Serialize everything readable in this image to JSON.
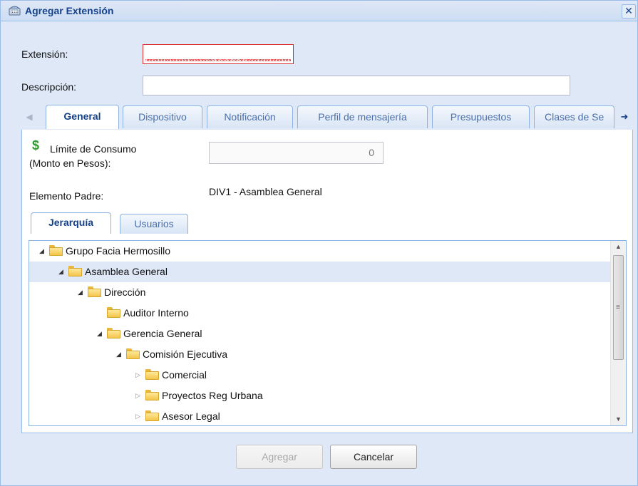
{
  "dialog": {
    "title": "Agregar Extensión",
    "close_symbol": "✕"
  },
  "form": {
    "extension_label": "Extensión:",
    "extension_value": "",
    "description_label": "Descripción:",
    "description_value": ""
  },
  "tabs": {
    "scroll_left_icon": "◀",
    "scroll_right_icon": "➜",
    "items": [
      {
        "label": "General",
        "active": true
      },
      {
        "label": "Dispositivo"
      },
      {
        "label": "Notificación"
      },
      {
        "label": "Perfil de mensajería"
      },
      {
        "label": "Presupuestos"
      },
      {
        "label": "Clases de Se"
      }
    ]
  },
  "general": {
    "currency_icon": "$",
    "limit_label_line1": "Límite de Consumo",
    "limit_label_line2": "(Monto en Pesos):",
    "limit_value": "0",
    "parent_label": "Elemento Padre:",
    "parent_value": "DIV1 - Asamblea General"
  },
  "subtabs": [
    {
      "label": "Jerarquía",
      "active": true
    },
    {
      "label": "Usuarios"
    }
  ],
  "tree": {
    "items": [
      {
        "label": "Grupo Facia Hermosillo",
        "level": 0,
        "expander": "◢"
      },
      {
        "label": "Asamblea General",
        "level": 1,
        "expander": "◢",
        "selected": true
      },
      {
        "label": "Dirección",
        "level": 2,
        "expander": "◢"
      },
      {
        "label": "Auditor Interno",
        "level": 3,
        "expander": ""
      },
      {
        "label": "Gerencia General",
        "level": 3,
        "expander": "◢"
      },
      {
        "label": "Comisión Ejecutiva",
        "level": 4,
        "expander": "◢"
      },
      {
        "label": "Comercial",
        "level": 5,
        "expander": "▷"
      },
      {
        "label": "Proyectos Reg Urbana",
        "level": 5,
        "expander": "▷"
      },
      {
        "label": "Asesor Legal",
        "level": 5,
        "expander": "▷"
      }
    ],
    "scroll_up_icon": "▲",
    "scroll_down_icon": "▼",
    "grip_icon": "≡"
  },
  "buttons": {
    "add_label": "Agregar",
    "cancel_label": "Cancelar"
  },
  "colors": {
    "accent": "#15428b",
    "border": "#99bbe8",
    "window_bg": "#dfe8f6",
    "selection": "#dfe8f6",
    "currency_green": "#2f9a2f"
  }
}
